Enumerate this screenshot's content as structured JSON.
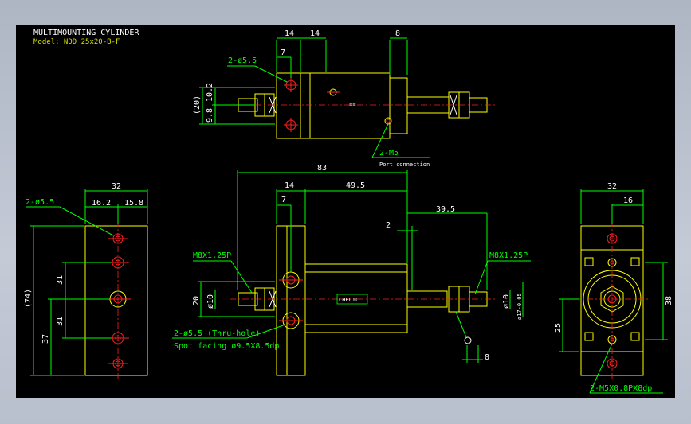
{
  "drawing": {
    "title": "MULTIMOUNTING CYLINDER",
    "model": "Model: NDD 25x20-B-F"
  },
  "top_view": {
    "dims": {
      "d14a": "14",
      "d14b": "14",
      "d8": "8",
      "d7": "7",
      "d20": "(20)",
      "d102": "10.2",
      "d98": "9.8"
    },
    "holes_label": "2-ø5.5",
    "port_label": "2-M5",
    "port_note": "Port connection"
  },
  "side_view": {
    "dims": {
      "d32": "32",
      "d162": "16.2",
      "d158": "15.8",
      "d74": "(74)",
      "d31a": "31",
      "d31b": "31",
      "d37": "37"
    },
    "holes_label": "2-ø5.5"
  },
  "front_view": {
    "dims": {
      "d83": "83",
      "d14": "14",
      "d495": "49.5",
      "d7": "7",
      "d2": "2",
      "d395": "39.5",
      "d20": "20",
      "dphi10a": "ø10",
      "dphi10b": "ø10",
      "dphi17": "ø17-0.05",
      "d8": "8"
    },
    "thread_left": "M8X1.25P",
    "thread_right": "M8X1.25P",
    "holes_label": "2-ø5.5 (Thru-hole)",
    "spot_facing": "Spot facing  ø9.5X8.5dp",
    "brand": "CHELIC"
  },
  "end_view": {
    "dims": {
      "d32": "32",
      "d16": "16",
      "d38": "38",
      "d25": "25"
    },
    "thread_label": "2-M5X0.8PX8dp"
  }
}
